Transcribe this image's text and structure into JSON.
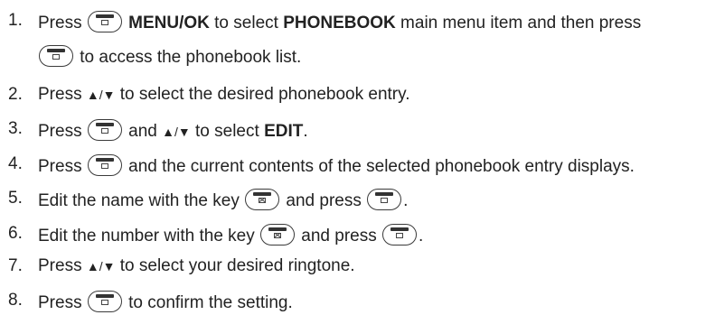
{
  "steps": [
    {
      "num": "1.",
      "t1": "Press ",
      "b1": "MENU/OK",
      "t2": " to select ",
      "b2": "PHONEBOOK",
      "t3": " main menu item and then press",
      "t4": " to access the phonebook list."
    },
    {
      "num": "2.",
      "t1": "Press ",
      "arrows": "▲/▼",
      "t2": " to select the desired phonebook entry."
    },
    {
      "num": "3.",
      "t1": "Press ",
      "t2": " and ",
      "arrows": "▲/▼",
      "t3": " to select ",
      "b1": "EDIT",
      "t4": "."
    },
    {
      "num": "4.",
      "t1": "Press ",
      "t2": " and the current contents of the selected phonebook entry displays."
    },
    {
      "num": "5.",
      "t1": "Edit the name with the key ",
      "t2": " and press ",
      "t3": "."
    },
    {
      "num": "6.",
      "t1": "Edit the number with the key ",
      "t2": " and press ",
      "t3": "."
    },
    {
      "num": "7.",
      "t1": "Press ",
      "arrows": "▲/▼",
      "t2": " to select your desired ringtone."
    },
    {
      "num": "8.",
      "t1": "Press ",
      "t2": " to confirm the setting."
    }
  ],
  "icons": {
    "menu_key": "menu-ok-key-icon",
    "clear_key": "clear-key-icon"
  }
}
